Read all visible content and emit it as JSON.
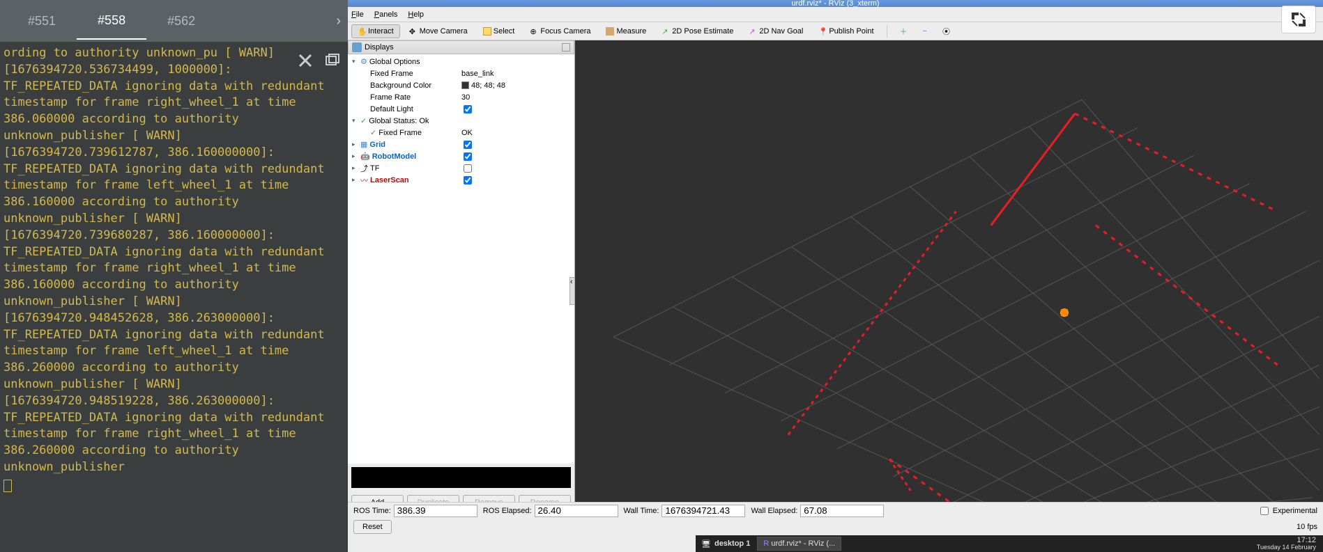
{
  "terminal": {
    "tabs": [
      "#551",
      "#558",
      "#562"
    ],
    "active_tab": 1,
    "log": "ording to authority unknown_pu\n[ WARN] [1676394720.536734499,\n1000000]: TF_REPEATED_DATA ignoring data with redundant timestamp for frame right_wheel_1 at time 386.060000 according to authority unknown_publisher\n[ WARN] [1676394720.739612787, 386.160000000]: TF_REPEATED_DATA ignoring data with redundant timestamp for frame left_wheel_1 at time 386.160000 according to authority unknown_publisher\n[ WARN] [1676394720.739680287, 386.160000000]: TF_REPEATED_DATA ignoring data with redundant timestamp for frame right_wheel_1 at time 386.160000 according to authority unknown_publisher\n[ WARN] [1676394720.948452628, 386.263000000]: TF_REPEATED_DATA ignoring data with redundant timestamp for frame left_wheel_1 at time 386.260000 according to authority unknown_publisher\n[ WARN] [1676394720.948519228, 386.263000000]: TF_REPEATED_DATA ignoring data with redundant timestamp for frame right_wheel_1 at time 386.260000 according to authority unknown_publisher"
  },
  "rviz": {
    "title": "urdf.rviz* - RViz (3_xterm)",
    "menu": {
      "file": "File",
      "panels": "Panels",
      "help": "Help"
    },
    "tools": {
      "interact": "Interact",
      "move_camera": "Move Camera",
      "select": "Select",
      "focus_camera": "Focus Camera",
      "measure": "Measure",
      "pose_estimate": "2D Pose Estimate",
      "nav_goal": "2D Nav Goal",
      "publish_point": "Publish Point"
    },
    "displays": {
      "header": "Displays",
      "global_options": {
        "label": "Global Options",
        "fixed_frame": {
          "label": "Fixed Frame",
          "value": "base_link"
        },
        "background_color": {
          "label": "Background Color",
          "value": "48; 48; 48",
          "hex": "#303030"
        },
        "frame_rate": {
          "label": "Frame Rate",
          "value": "30"
        },
        "default_light": {
          "label": "Default Light",
          "checked": true
        }
      },
      "global_status": {
        "label": "Global Status: Ok",
        "fixed_frame": {
          "label": "Fixed Frame",
          "value": "OK"
        }
      },
      "items": [
        {
          "name": "Grid",
          "checked": true,
          "color": "#0066cc"
        },
        {
          "name": "RobotModel",
          "checked": true,
          "color": "#0066cc"
        },
        {
          "name": "TF",
          "checked": false,
          "color": "#000"
        },
        {
          "name": "LaserScan",
          "checked": true,
          "color": "#cc0000"
        }
      ],
      "buttons": {
        "add": "Add",
        "duplicate": "Duplicate",
        "remove": "Remove",
        "rename": "Rename"
      }
    },
    "status": {
      "ros_time": {
        "label": "ROS Time:",
        "value": "386.39"
      },
      "ros_elapsed": {
        "label": "ROS Elapsed:",
        "value": "26.40"
      },
      "wall_time": {
        "label": "Wall Time:",
        "value": "1676394721.43"
      },
      "wall_elapsed": {
        "label": "Wall Elapsed:",
        "value": "67.08"
      },
      "experimental": "Experimental",
      "reset": "Reset",
      "fps": "10 fps"
    }
  },
  "taskbar": {
    "desktop": "desktop 1",
    "app": "urdf.rviz* - RViz (...",
    "time": "17:12",
    "date": "Tuesday 14 February"
  }
}
